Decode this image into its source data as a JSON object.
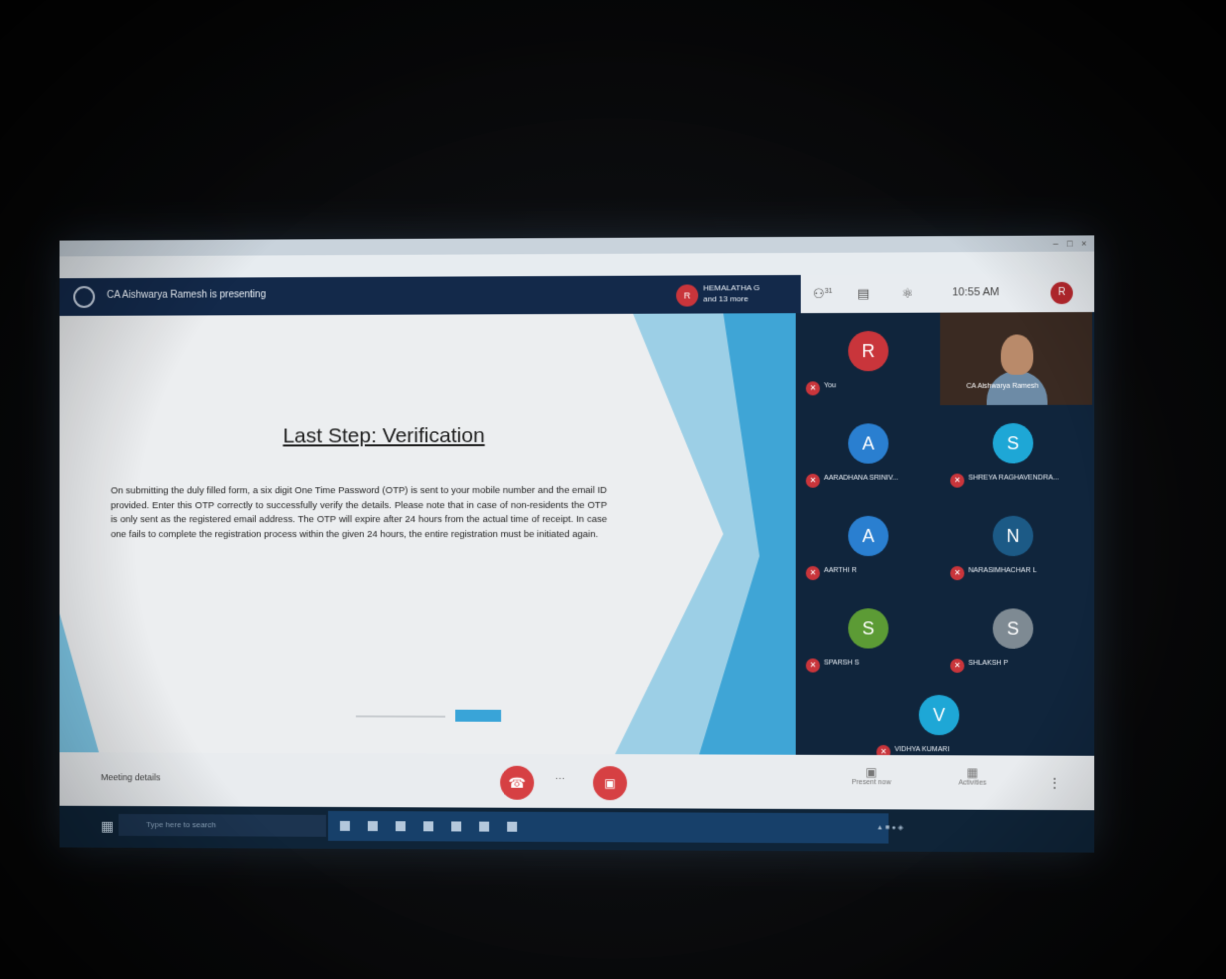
{
  "meeting": {
    "presenter_text": "CA Aishwarya Ramesh is presenting",
    "raised_hand_initial": "R",
    "raised_hand_text_line1": "HEMALATHA G",
    "raised_hand_text_line2": "and 13 more",
    "participant_count": "31",
    "clock": "10:55 AM",
    "user_initial": "R"
  },
  "slide": {
    "title": "Last Step:  Verification",
    "body": "On submitting the duly filled form, a six digit One Time Password (OTP) is sent to your mobile number and the email ID provided. Enter this OTP correctly to successfully verify the details. Please note that in case of non-residents the OTP is only sent as the registered email address. The OTP will expire after 24 hours from the actual time of receipt. In case one fails to complete the registration process within the given 24 hours, the entire registration must be initiated again."
  },
  "participants": [
    {
      "initial": "R",
      "name": "You",
      "color": "#c9353b"
    },
    {
      "initial": "A",
      "name": "AARADHANA SRINIV...",
      "color": "#2a7fd0"
    },
    {
      "initial": "S",
      "name": "SHREYA RAGHAVENDRA...",
      "color": "#1ea7d6"
    },
    {
      "initial": "A",
      "name": "AARTHI R",
      "color": "#2a7fd0"
    },
    {
      "initial": "N",
      "name": "NARASIMHACHAR L",
      "color": "#1c5a86"
    },
    {
      "initial": "S",
      "name": "SPARSH S",
      "color": "#5c9b35"
    },
    {
      "initial": "S",
      "name": "SHLAKSH P",
      "color": "#7e8a93"
    },
    {
      "initial": "V",
      "name": "VIDHYA KUMARI",
      "color": "#1ea7d6"
    }
  ],
  "video_participant": {
    "name": "CA Aishwarya Ramesh"
  },
  "bottom_bar": {
    "meeting_details": "Meeting details",
    "present_now": "Present now",
    "activities": "Activities"
  },
  "taskbar": {
    "search_placeholder": "Type here to search"
  }
}
